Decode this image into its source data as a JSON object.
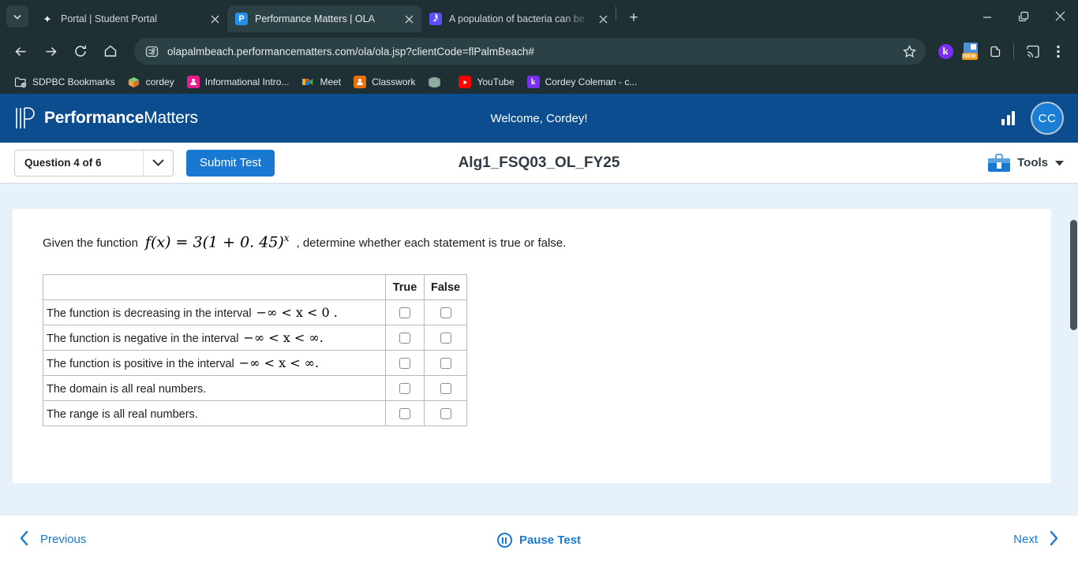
{
  "browser": {
    "tabs": [
      {
        "title": "Portal | Student Portal",
        "favicon": "portal-icon",
        "active": false
      },
      {
        "title": "Performance Matters | OLA",
        "favicon": "pm-icon",
        "active": true
      },
      {
        "title": "A population of bacteria can be",
        "favicon": "doc-icon",
        "active": false
      }
    ],
    "new_tab_label": "+",
    "url": "olapalmbeach.performancematters.com/ola/ola.jsp?clientCode=flPalmBeach#",
    "nav": {
      "back": "back-arrow-icon",
      "forward": "forward-arrow-icon",
      "reload": "reload-icon",
      "home": "home-icon"
    },
    "extensions": [
      {
        "name": "kami-extension",
        "label": "k"
      },
      {
        "name": "new-extension",
        "label": "NEW"
      },
      {
        "name": "puzzle-extension",
        "label": ""
      }
    ],
    "bookmarks": [
      {
        "label": "SDPBC Bookmarks",
        "icon": "folder-icon"
      },
      {
        "label": "cordey",
        "icon": "cube-icon"
      },
      {
        "label": "Informational Intro...",
        "icon": "classroom-pink-icon"
      },
      {
        "label": "Meet",
        "icon": "meet-icon"
      },
      {
        "label": "Classwork",
        "icon": "classroom-orange-icon"
      },
      {
        "label": "",
        "icon": "globe-icon"
      },
      {
        "label": "YouTube",
        "icon": "youtube-icon"
      },
      {
        "label": "Cordey Coleman - c...",
        "icon": "kami-icon"
      }
    ],
    "window_controls": {
      "minimize": "minimize-icon",
      "maximize": "maximize-icon",
      "close": "close-icon"
    }
  },
  "app": {
    "brand_bold": "Performance",
    "brand_light": "Matters",
    "welcome": "Welcome, Cordey!",
    "avatar_initials": "CC",
    "chart_icon": "bar-chart-icon",
    "accent_blue": "#1878d2",
    "header_blue": "#0b4d8f"
  },
  "subbar": {
    "question_select": "Question 4 of 6",
    "submit_label": "Submit Test",
    "test_title": "Alg1_FSQ03_OL_FY25",
    "tools_label": "Tools"
  },
  "question": {
    "prefix": "Given the function",
    "formula": "f(x) = 3(1 + 0. 45)",
    "formula_exponent": "x",
    "suffix": ", determine whether each statement is true or false.",
    "table": {
      "headers": [
        "",
        "True",
        "False"
      ],
      "rows": [
        {
          "statement": "The function is decreasing in the interval",
          "interval": "−∞ < x < 0 .",
          "true_checked": false,
          "false_checked": false
        },
        {
          "statement": "The function is negative in the interval",
          "interval": "−∞ < x < ∞.",
          "true_checked": false,
          "false_checked": false
        },
        {
          "statement": "The function is positive in the interval",
          "interval": "−∞ < x < ∞.",
          "true_checked": false,
          "false_checked": false
        },
        {
          "statement": "The domain is all real numbers.",
          "interval": "",
          "true_checked": false,
          "false_checked": false
        },
        {
          "statement": "The range is all real numbers.",
          "interval": "",
          "true_checked": false,
          "false_checked": false
        }
      ]
    }
  },
  "footer": {
    "previous_label": "Previous",
    "pause_label": "Pause Test",
    "next_label": "Next"
  }
}
